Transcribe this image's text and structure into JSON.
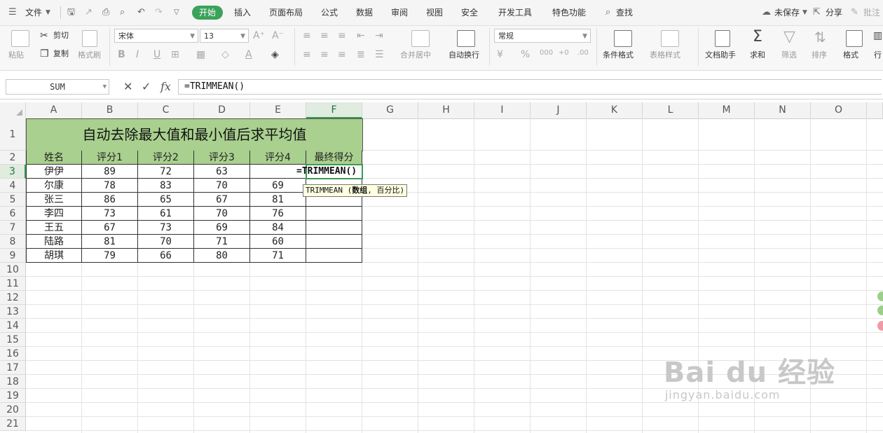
{
  "menubar": {
    "file_label": "文件",
    "tabs": [
      "开始",
      "插入",
      "页面布局",
      "公式",
      "数据",
      "审阅",
      "视图",
      "安全",
      "开发工具",
      "特色功能"
    ],
    "active_tab": "开始",
    "search_label": "查找",
    "unsaved_label": "未保存",
    "share_label": "分享",
    "annotate_label": "批注"
  },
  "ribbon": {
    "paste_label": "粘贴",
    "cut_label": "剪切",
    "copy_label": "复制",
    "format_painter_label": "格式刷",
    "font_name": "宋体",
    "font_size": "13",
    "merge_label": "合并居中",
    "wrap_label": "自动换行",
    "number_format": "常规",
    "cond_format_label": "条件格式",
    "table_style_label": "表格样式",
    "doc_helper_label": "文档助手",
    "sum_label": "求和",
    "filter_label": "筛选",
    "sort_label": "排序",
    "format_label": "格式",
    "row_col_label": "行"
  },
  "formula_bar": {
    "name_box": "SUM",
    "formula": "=TRIMMEAN()"
  },
  "columns": [
    "A",
    "B",
    "C",
    "D",
    "E",
    "F",
    "G",
    "H",
    "I",
    "J",
    "K",
    "L",
    "M",
    "N",
    "O"
  ],
  "rows": [
    "1",
    "2",
    "3",
    "4",
    "5",
    "6",
    "7",
    "8",
    "9",
    "10",
    "11",
    "12",
    "13",
    "14",
    "15",
    "16",
    "17",
    "18",
    "19",
    "20",
    "21"
  ],
  "sheet": {
    "title": "自动去除最大值和最小值后求平均值",
    "headers": [
      "姓名",
      "评分1",
      "评分2",
      "评分3",
      "评分4",
      "最终得分"
    ],
    "records": [
      [
        "伊伊",
        "89",
        "72",
        "63",
        ""
      ],
      [
        "尔康",
        "78",
        "83",
        "70",
        "69"
      ],
      [
        "张三",
        "86",
        "65",
        "67",
        "81"
      ],
      [
        "李四",
        "73",
        "61",
        "70",
        "76"
      ],
      [
        "王五",
        "67",
        "73",
        "69",
        "84"
      ],
      [
        "陆路",
        "81",
        "70",
        "71",
        "60"
      ],
      [
        "胡琪",
        "79",
        "66",
        "80",
        "71"
      ]
    ]
  },
  "editor": {
    "text": "=TRIMMEAN()",
    "tooltip_fn": "TRIMMEAN",
    "tooltip_arg1": "数组",
    "tooltip_arg2": "百分比"
  },
  "watermark": {
    "logo": "Bai du 经验",
    "url": "jingyan.baidu.com"
  },
  "colors": {
    "accent": "#3aa35a",
    "title_fill": "#a9d08e",
    "tooltip_bg": "#ffffe1"
  }
}
